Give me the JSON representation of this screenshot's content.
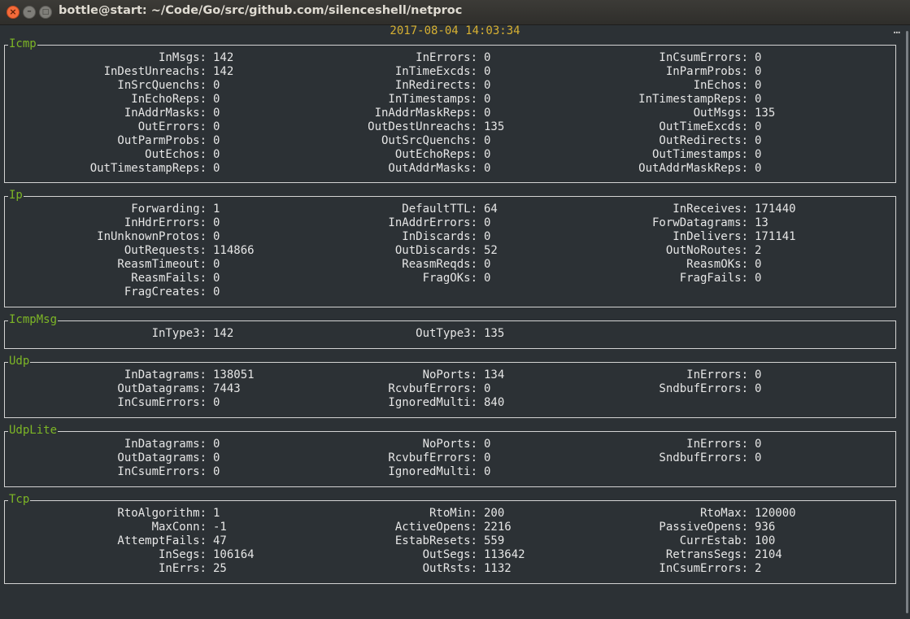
{
  "window": {
    "title": "bottle@start: ~/Code/Go/src/github.com/silenceshell/netproc"
  },
  "header": {
    "timestamp": "2017-08-04 14:03:34",
    "more": "…"
  },
  "sections": [
    {
      "name": "Icmp",
      "stats": [
        {
          "label": "InMsgs:",
          "value": "142"
        },
        {
          "label": "InErrors:",
          "value": "0"
        },
        {
          "label": "InCsumErrors:",
          "value": "0"
        },
        {
          "label": "InDestUnreachs:",
          "value": "142"
        },
        {
          "label": "InTimeExcds:",
          "value": "0"
        },
        {
          "label": "InParmProbs:",
          "value": "0"
        },
        {
          "label": "InSrcQuenchs:",
          "value": "0"
        },
        {
          "label": "InRedirects:",
          "value": "0"
        },
        {
          "label": "InEchos:",
          "value": "0"
        },
        {
          "label": "InEchoReps:",
          "value": "0"
        },
        {
          "label": "InTimestamps:",
          "value": "0"
        },
        {
          "label": "InTimestampReps:",
          "value": "0"
        },
        {
          "label": "InAddrMasks:",
          "value": "0"
        },
        {
          "label": "InAddrMaskReps:",
          "value": "0"
        },
        {
          "label": "OutMsgs:",
          "value": "135"
        },
        {
          "label": "OutErrors:",
          "value": "0"
        },
        {
          "label": "OutDestUnreachs:",
          "value": "135"
        },
        {
          "label": "OutTimeExcds:",
          "value": "0"
        },
        {
          "label": "OutParmProbs:",
          "value": "0"
        },
        {
          "label": "OutSrcQuenchs:",
          "value": "0"
        },
        {
          "label": "OutRedirects:",
          "value": "0"
        },
        {
          "label": "OutEchos:",
          "value": "0"
        },
        {
          "label": "OutEchoReps:",
          "value": "0"
        },
        {
          "label": "OutTimestamps:",
          "value": "0"
        },
        {
          "label": "OutTimestampReps:",
          "value": "0"
        },
        {
          "label": "OutAddrMasks:",
          "value": "0"
        },
        {
          "label": "OutAddrMaskReps:",
          "value": "0"
        }
      ]
    },
    {
      "name": "Ip",
      "stats": [
        {
          "label": "Forwarding:",
          "value": "1"
        },
        {
          "label": "DefaultTTL:",
          "value": "64"
        },
        {
          "label": "InReceives:",
          "value": "171440"
        },
        {
          "label": "InHdrErrors:",
          "value": "0"
        },
        {
          "label": "InAddrErrors:",
          "value": "0"
        },
        {
          "label": "ForwDatagrams:",
          "value": "13"
        },
        {
          "label": "InUnknownProtos:",
          "value": "0"
        },
        {
          "label": "InDiscards:",
          "value": "0"
        },
        {
          "label": "InDelivers:",
          "value": "171141"
        },
        {
          "label": "OutRequests:",
          "value": "114866"
        },
        {
          "label": "OutDiscards:",
          "value": "52"
        },
        {
          "label": "OutNoRoutes:",
          "value": "2"
        },
        {
          "label": "ReasmTimeout:",
          "value": "0"
        },
        {
          "label": "ReasmReqds:",
          "value": "0"
        },
        {
          "label": "ReasmOKs:",
          "value": "0"
        },
        {
          "label": "ReasmFails:",
          "value": "0"
        },
        {
          "label": "FragOKs:",
          "value": "0"
        },
        {
          "label": "FragFails:",
          "value": "0"
        },
        {
          "label": "FragCreates:",
          "value": "0"
        }
      ]
    },
    {
      "name": "IcmpMsg",
      "stats": [
        {
          "label": "InType3:",
          "value": "142"
        },
        {
          "label": "OutType3:",
          "value": "135"
        }
      ]
    },
    {
      "name": "Udp",
      "stats": [
        {
          "label": "InDatagrams:",
          "value": "138051"
        },
        {
          "label": "NoPorts:",
          "value": "134"
        },
        {
          "label": "InErrors:",
          "value": "0"
        },
        {
          "label": "OutDatagrams:",
          "value": "7443"
        },
        {
          "label": "RcvbufErrors:",
          "value": "0"
        },
        {
          "label": "SndbufErrors:",
          "value": "0"
        },
        {
          "label": "InCsumErrors:",
          "value": "0"
        },
        {
          "label": "IgnoredMulti:",
          "value": "840"
        }
      ]
    },
    {
      "name": "UdpLite",
      "stats": [
        {
          "label": "InDatagrams:",
          "value": "0"
        },
        {
          "label": "NoPorts:",
          "value": "0"
        },
        {
          "label": "InErrors:",
          "value": "0"
        },
        {
          "label": "OutDatagrams:",
          "value": "0"
        },
        {
          "label": "RcvbufErrors:",
          "value": "0"
        },
        {
          "label": "SndbufErrors:",
          "value": "0"
        },
        {
          "label": "InCsumErrors:",
          "value": "0"
        },
        {
          "label": "IgnoredMulti:",
          "value": "0"
        }
      ]
    },
    {
      "name": "Tcp",
      "stats": [
        {
          "label": "RtoAlgorithm:",
          "value": "1"
        },
        {
          "label": "RtoMin:",
          "value": "200"
        },
        {
          "label": "RtoMax:",
          "value": "120000"
        },
        {
          "label": "MaxConn:",
          "value": "-1"
        },
        {
          "label": "ActiveOpens:",
          "value": "2216"
        },
        {
          "label": "PassiveOpens:",
          "value": "936"
        },
        {
          "label": "AttemptFails:",
          "value": "47"
        },
        {
          "label": "EstabResets:",
          "value": "559"
        },
        {
          "label": "CurrEstab:",
          "value": "100"
        },
        {
          "label": "InSegs:",
          "value": "106164"
        },
        {
          "label": "OutSegs:",
          "value": "113642"
        },
        {
          "label": "RetransSegs:",
          "value": "2104"
        },
        {
          "label": "InErrs:",
          "value": "25"
        },
        {
          "label": "OutRsts:",
          "value": "1132"
        },
        {
          "label": "InCsumErrors:",
          "value": "2"
        }
      ]
    }
  ],
  "colors": {
    "background": "#2c3135",
    "text": "#e6e6e6",
    "section_title": "#7db626",
    "timestamp": "#d6b032",
    "border": "#d3d3d3"
  }
}
